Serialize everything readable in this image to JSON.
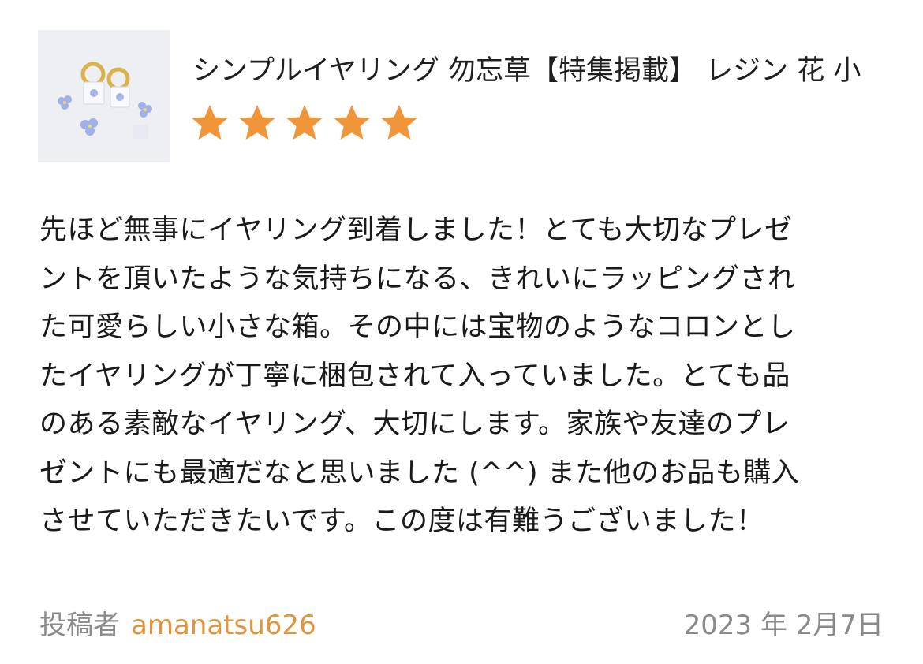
{
  "product": {
    "title": "シンプルイヤリング 勿忘草【特集掲載】 レジン 花 小",
    "rating": 5,
    "rating_max": 5,
    "star_color": "#F0953A",
    "thumbnail_icon": "earring-product-photo"
  },
  "review": {
    "lines": [
      "先ほど無事にイヤリング到着しました！とても大切なプレゼ",
      "ントを頂いたような気持ちになる、きれいにラッピングされ",
      "た可愛らしい小さな箱。その中には宝物のようなコロンとし",
      "たイヤリングが丁寧に梱包されて入っていました。とても品",
      "のある素敵なイヤリング、大切にします。家族や友達のプレ",
      "ゼントにも最適だなと思いました (^^) また他のお品も購入",
      "させていただきたいです。この度は有難うございました！"
    ]
  },
  "meta": {
    "poster_label": "投稿者",
    "poster_name": "amanatsu626",
    "poster_color": "#E2933D",
    "date": "2023 年 2月7日"
  }
}
